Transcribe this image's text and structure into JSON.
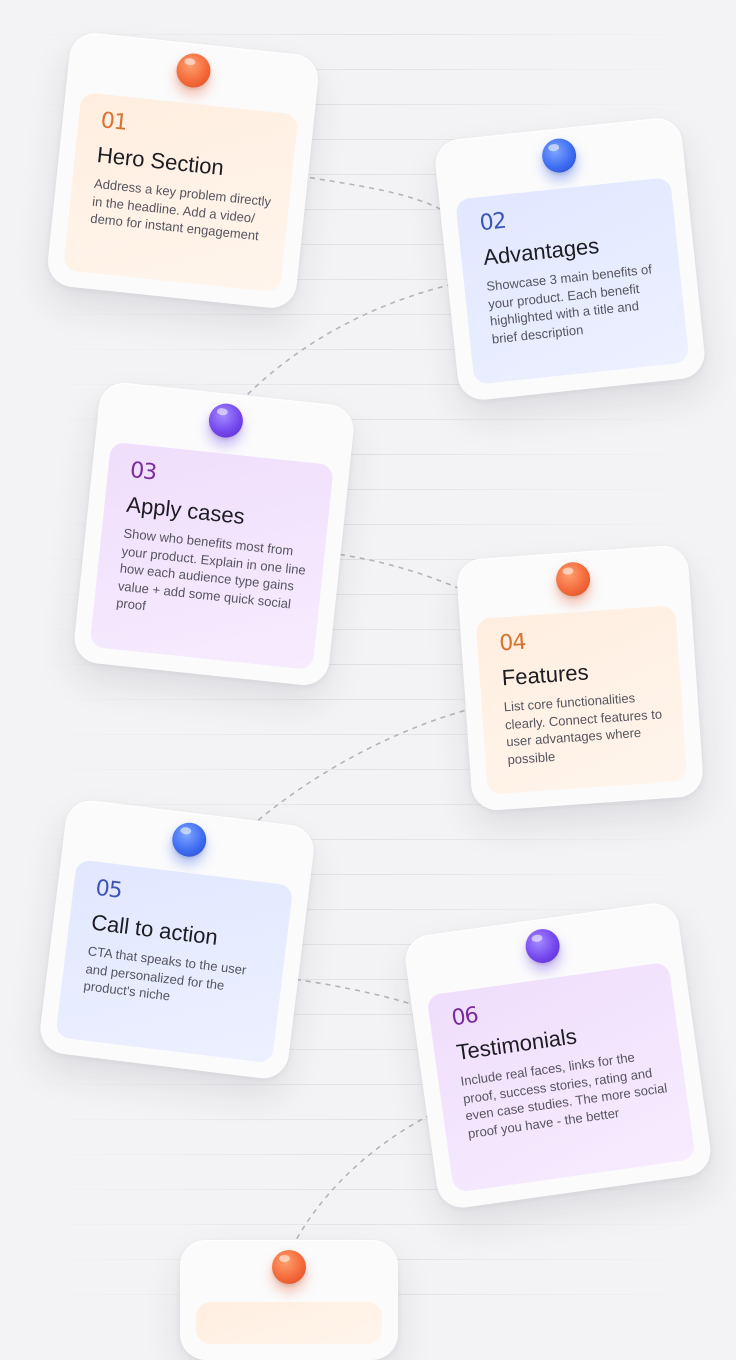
{
  "theme": {
    "background": "#f3f3f5",
    "orange_accent": "#f46a3a",
    "blue_accent": "#3f6df2",
    "purple_accent": "#7548ee"
  },
  "cards": [
    {
      "number": "01",
      "title": "Hero Section",
      "description": "Address a key problem directly in the headline. Add a video/ demo for instant engagement",
      "color": "orange",
      "pin_icon": "pushpin-icon"
    },
    {
      "number": "02",
      "title": "Advantages",
      "description": "Showcase 3 main benefits of your product. Each benefit highlighted with a title and brief description",
      "color": "blue",
      "pin_icon": "pushpin-icon"
    },
    {
      "number": "03",
      "title": "Apply cases",
      "description": "Show who benefits most from your product. Explain in one line how each audience type gains value + add some quick social proof",
      "color": "purple",
      "pin_icon": "pushpin-icon"
    },
    {
      "number": "04",
      "title": "Features",
      "description": "List core functionalities clearly. Connect features to user advantages where possible",
      "color": "orange",
      "pin_icon": "pushpin-icon"
    },
    {
      "number": "05",
      "title": "Call to action",
      "description": "CTA that speaks to the user and personalized for the product's niche",
      "color": "blue",
      "pin_icon": "pushpin-icon"
    },
    {
      "number": "06",
      "title": "Testimonials",
      "description": "Include real faces, links for the proof, success stories, rating and even case studies. The more social proof you have - the better",
      "color": "purple",
      "pin_icon": "pushpin-icon"
    },
    {
      "color": "orange",
      "pin_icon": "pushpin-icon"
    }
  ]
}
